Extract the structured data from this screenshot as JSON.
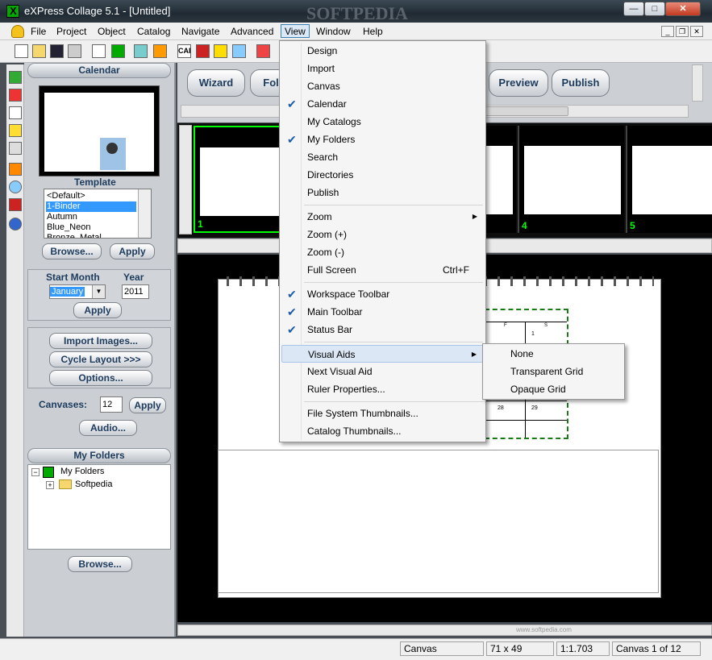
{
  "window": {
    "title": "eXPress Collage 5.1 - [Untitled]",
    "min": "—",
    "max": "□",
    "close": "✕",
    "watermark": "SOFTPEDIA"
  },
  "menubar": {
    "items": [
      "File",
      "Project",
      "Object",
      "Catalog",
      "Navigate",
      "Advanced",
      "View",
      "Window",
      "Help"
    ],
    "mdi": [
      "_",
      "❐",
      "✕"
    ]
  },
  "toolbar": {
    "icons": [
      "new-icon",
      "open-icon",
      "save-icon",
      "print-icon",
      "preview-icon",
      "collage-icon",
      "thumbnails-icon",
      "gallery-icon",
      "cap-icon",
      "sort-icon",
      "music-icon",
      "waves-icon",
      "tools-icon"
    ],
    "cap_label": "CAP"
  },
  "left_panel": {
    "calendar_header": "Calendar",
    "template_label": "Template",
    "templates": [
      "<Default>",
      "1-Binder",
      "Autumn",
      "Blue_Neon",
      "Bronze_Metal"
    ],
    "selected_template": "1-Binder",
    "browse_label": "Browse...",
    "apply_label": "Apply",
    "start_month_label": "Start Month",
    "year_label": "Year",
    "start_month_value": "January",
    "year_value": "2011",
    "apply2_label": "Apply",
    "import_images_label": "Import Images...",
    "cycle_layout_label": "Cycle Layout >>>",
    "options_label": "Options...",
    "canvases_label": "Canvases:",
    "canvases_value": "12",
    "apply3_label": "Apply",
    "audio_label": "Audio...",
    "my_folders_header": "My Folders",
    "tree_root": "My Folders",
    "tree_child": "Softpedia",
    "browse2_label": "Browse..."
  },
  "workspace_toolbar": {
    "wizard": "Wizard",
    "folders": "Fold",
    "preview": "Preview",
    "publish": "Publish"
  },
  "thumbnails": {
    "numbers": [
      "1",
      "4",
      "5"
    ]
  },
  "calendar_cells": [
    "F",
    "S",
    "1",
    "28",
    "29"
  ],
  "status_bar": {
    "mode": "Canvas",
    "size": "71 x 49",
    "zoom": "1:1.703",
    "canvas_of": "Canvas 1 of 12",
    "credit": "www.softpedia.com"
  },
  "view_menu": {
    "items": [
      {
        "label": "Design",
        "checked": false
      },
      {
        "label": "Import",
        "checked": false
      },
      {
        "label": "Canvas",
        "checked": false
      },
      {
        "label": "Calendar",
        "checked": true
      },
      {
        "label": "My Catalogs",
        "checked": false
      },
      {
        "label": "My Folders",
        "checked": true
      },
      {
        "label": "Search",
        "checked": false
      },
      {
        "label": "Directories",
        "checked": false
      },
      {
        "label": "Publish",
        "checked": false
      },
      {
        "label": "Zoom",
        "checked": false,
        "submenu": true
      },
      {
        "label": "Zoom (+)",
        "checked": false
      },
      {
        "label": "Zoom (-)",
        "checked": false
      },
      {
        "label": "Full Screen",
        "checked": false,
        "shortcut": "Ctrl+F"
      },
      {
        "label": "Workspace Toolbar",
        "checked": true
      },
      {
        "label": "Main Toolbar",
        "checked": true
      },
      {
        "label": "Status Bar",
        "checked": true
      },
      {
        "label": "Visual Aids",
        "checked": false,
        "submenu": true,
        "highlighted": true
      },
      {
        "label": "Next Visual Aid",
        "checked": false
      },
      {
        "label": "Ruler Properties...",
        "checked": false
      },
      {
        "label": "File System Thumbnails...",
        "checked": false
      },
      {
        "label": "Catalog Thumbnails...",
        "checked": false
      }
    ]
  },
  "visual_aids_menu": {
    "items": [
      "None",
      "Transparent Grid",
      "Opaque Grid"
    ]
  },
  "colors": {
    "accent": "#1d3b5c",
    "selection": "#3399ff",
    "check": "#1c5ca8",
    "thumb_number": "#00ff00"
  }
}
